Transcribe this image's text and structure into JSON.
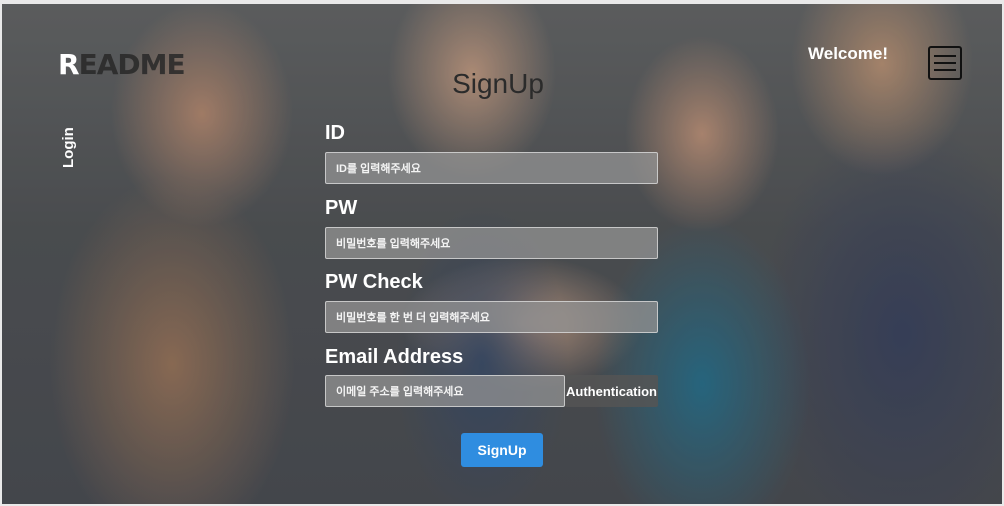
{
  "header": {
    "logo_first": "R",
    "logo_rest": "EADME",
    "welcome": "Welcome!",
    "menu_icon": "hamburger-icon"
  },
  "sidebar": {
    "login": "Login"
  },
  "form": {
    "title": "SignUp",
    "id_label": "ID",
    "id_placeholder": "ID를 입력해주세요",
    "pw_label": "PW",
    "pw_placeholder": "비밀번호를 입력해주세요",
    "pw_check_label": "PW Check",
    "pw_check_placeholder": "비밀번호를 한 번 더 입력해주세요",
    "email_label": "Email Address",
    "email_placeholder": "이메일 주소를 입력해주세요",
    "auth_button": "Authentication",
    "submit_button": "SignUp"
  },
  "colors": {
    "submit": "#2f8de0",
    "auth": "#555555"
  }
}
